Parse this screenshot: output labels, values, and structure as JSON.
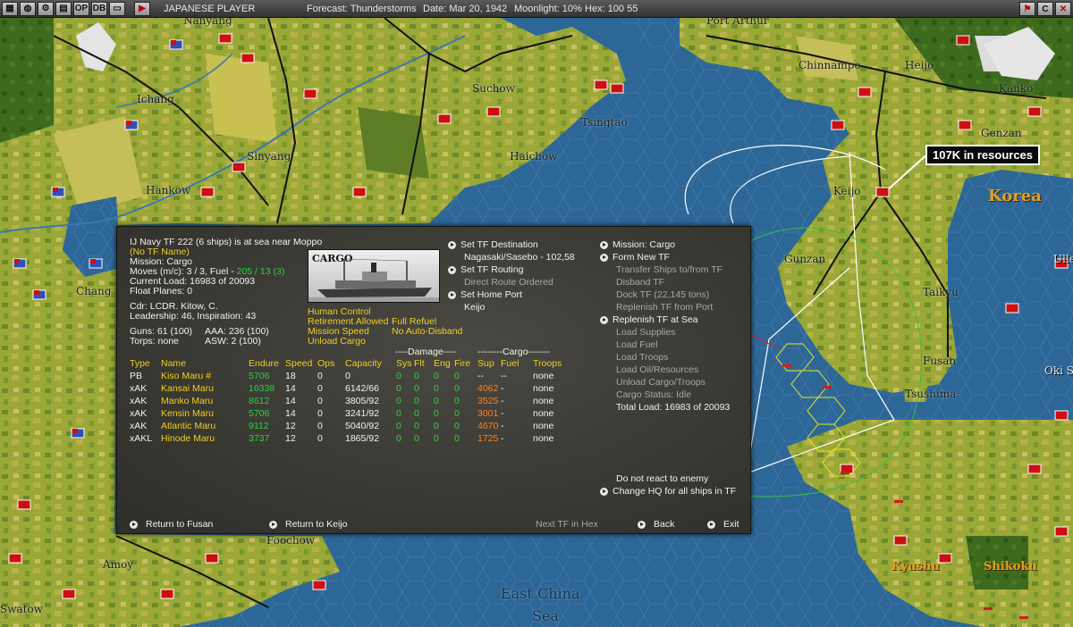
{
  "topbar": {
    "player": "JAPANESE PLAYER",
    "forecast": "Forecast: Thunderstorms",
    "date": "Date: Mar 20, 1942",
    "moonlight": "Moonlight: 10%",
    "hex": "Hex: 100 55",
    "buttons_left": [
      "map-icon",
      "globe-icon",
      "settings-icon",
      "chart-icon",
      "op-icon",
      "db-icon",
      "window-icon",
      "play-icon"
    ],
    "op_label": "OP",
    "db_label": "DB",
    "buttons_right": [
      "flag-icon",
      "c-icon",
      "x-icon"
    ],
    "c_label": "C"
  },
  "map": {
    "cities": [
      {
        "name": "Nanyang"
      },
      {
        "name": "Port Arthur"
      },
      {
        "name": "Chinnampo"
      },
      {
        "name": "Heijo"
      },
      {
        "name": "Kanko"
      },
      {
        "name": "Ichang"
      },
      {
        "name": "Suchow"
      },
      {
        "name": "Tsingtao"
      },
      {
        "name": "Genzan"
      },
      {
        "name": "Sinyang"
      },
      {
        "name": "Haichow"
      },
      {
        "name": "Hankow"
      },
      {
        "name": "Keijo"
      },
      {
        "name": "Gunzan"
      },
      {
        "name": "Taikyu"
      },
      {
        "name": "Fusan"
      },
      {
        "name": "Tsushima"
      },
      {
        "name": "Ulle"
      },
      {
        "name": "Oki S"
      },
      {
        "name": "Chang"
      },
      {
        "name": "Foochow"
      },
      {
        "name": "Amoy"
      },
      {
        "name": "Swatow"
      }
    ],
    "regions": [
      "Korea",
      "Kyushu",
      "Shikoku"
    ],
    "sea_label_1": "East China",
    "sea_label_2": "Sea",
    "callout": "107K in resources"
  },
  "panel": {
    "tf_title": "IJ Navy TF 222 (6 ships) is at sea near Moppo",
    "tf_name": "(No TF Name)",
    "mission": "Mission: Cargo",
    "moves_prefix": "Moves (m/c): 3 / 3, Fuel - ",
    "moves_fuel": "205 / 13 (3)",
    "current_load": "Current Load: 16983 of 20093",
    "float_planes": "Float Planes: 0",
    "cdr": "Cdr: LCDR. Kitow, C.",
    "leadership": "Leadership: 46, Inspiration: 43",
    "guns": "Guns: 61 (100)",
    "aaa": "AAA: 236 (100)",
    "torps": "Torps: none",
    "asw": "ASW: 2 (100)",
    "photo_title": "CARGO",
    "human_control": "Human Control",
    "retirement": "Retirement Allowed",
    "full_refuel": "Full Refuel",
    "mission_speed": "Mission Speed",
    "no_auto_disband": "No Auto-Disband",
    "unload_cargo": "Unload Cargo",
    "mid_commands": [
      {
        "label": "Set TF Destination",
        "active": true
      },
      {
        "label": "Nagasaki/Sasebo - 102,58",
        "active": false
      },
      {
        "label": "Set TF Routing",
        "active": true
      },
      {
        "label": "Direct Route Ordered",
        "active": false,
        "gray": true
      },
      {
        "label": "Set Home Port",
        "active": true
      },
      {
        "label": "Keijo",
        "active": false
      }
    ],
    "right_commands": [
      {
        "label": "Mission: Cargo",
        "arrow": true,
        "gray": false
      },
      {
        "label": "Form New TF",
        "arrow": true,
        "gray": false
      },
      {
        "label": "Transfer Ships to/from TF",
        "arrow": false,
        "gray": true
      },
      {
        "label": "Disband TF",
        "arrow": false,
        "gray": true
      },
      {
        "label": "Dock TF (22,145 tons)",
        "arrow": false,
        "gray": true
      },
      {
        "label": "Replenish TF from Port",
        "arrow": false,
        "gray": true
      },
      {
        "label": "Replenish TF at Sea",
        "arrow": true,
        "gray": false
      },
      {
        "label": "Load Supplies",
        "arrow": false,
        "gray": true
      },
      {
        "label": "Load Fuel",
        "arrow": false,
        "gray": true
      },
      {
        "label": "Load Troops",
        "arrow": false,
        "gray": true
      },
      {
        "label": "Load Oil/Resources",
        "arrow": false,
        "gray": true
      },
      {
        "label": "Unload Cargo/Troops",
        "arrow": false,
        "gray": true
      },
      {
        "label": "Cargo Status: Idle",
        "arrow": false,
        "gray": true
      },
      {
        "label": "Total Load: 16983 of 20093",
        "arrow": false,
        "gray": false
      }
    ],
    "damage_header": "----Damage----",
    "cargo_header": "--------Cargo-------",
    "columns": [
      "Type",
      "Name",
      "Endure",
      "Speed",
      "Ops",
      "Capacity",
      "Sys",
      "Flt",
      "Eng",
      "Fire",
      "Sup",
      "Fuel",
      "Troops"
    ],
    "ships": [
      {
        "type": "PB",
        "name": "Kiso Maru #",
        "endure": "5706",
        "speed": "18",
        "ops": "0",
        "capacity": "0",
        "sys": "0",
        "flt": "0",
        "eng": "0",
        "fire": "0",
        "sup": "--",
        "fuel": "--",
        "troops": "none"
      },
      {
        "type": "xAK",
        "name": "Kansai Maru",
        "endure": "16338",
        "speed": "14",
        "ops": "0",
        "capacity": "6142/66",
        "sys": "0",
        "flt": "0",
        "eng": "0",
        "fire": "0",
        "sup": "4062",
        "fuel": "-",
        "troops": "none"
      },
      {
        "type": "xAK",
        "name": "Manko Maru",
        "endure": "8612",
        "speed": "14",
        "ops": "0",
        "capacity": "3805/92",
        "sys": "0",
        "flt": "0",
        "eng": "0",
        "fire": "0",
        "sup": "3525",
        "fuel": "-",
        "troops": "none"
      },
      {
        "type": "xAK",
        "name": "Kensin Maru",
        "endure": "5706",
        "speed": "14",
        "ops": "0",
        "capacity": "3241/92",
        "sys": "0",
        "flt": "0",
        "eng": "0",
        "fire": "0",
        "sup": "3001",
        "fuel": "-",
        "troops": "none"
      },
      {
        "type": "xAK",
        "name": "Atlantic Maru",
        "endure": "9112",
        "speed": "12",
        "ops": "0",
        "capacity": "5040/92",
        "sys": "0",
        "flt": "0",
        "eng": "0",
        "fire": "0",
        "sup": "4670",
        "fuel": "-",
        "troops": "none"
      },
      {
        "type": "xAKL",
        "name": "Hinode Maru",
        "endure": "3737",
        "speed": "12",
        "ops": "0",
        "capacity": "1865/92",
        "sys": "0",
        "flt": "0",
        "eng": "0",
        "fire": "0",
        "sup": "1725",
        "fuel": "-",
        "troops": "none"
      }
    ],
    "do_not_react": "Do not react to enemy",
    "change_hq": "Change HQ for all ships in TF",
    "return_fusan": "Return to Fusan",
    "return_keijo": "Return to Keijo",
    "next_tf": "Next TF in Hex",
    "back": "Back",
    "exit": "Exit"
  }
}
